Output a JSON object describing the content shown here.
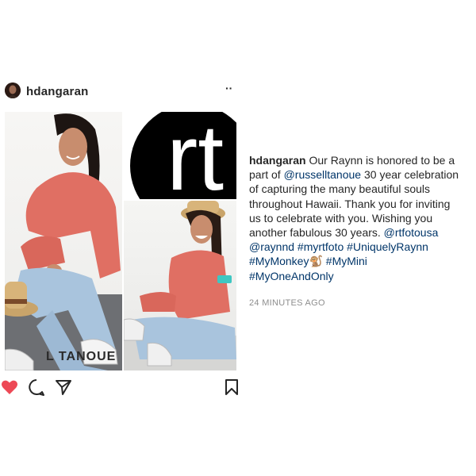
{
  "post": {
    "username": "hdangaran",
    "more_label": "··",
    "watermark": "L TANOUE",
    "logo_text": "rt"
  },
  "caption": {
    "username": "hdangaran",
    "text_part1": "Our Raynn is honored to be a part of",
    "mention_russell": "@russelltanoue",
    "text_part2": "30 year celebration of capturing the many beautiful souls throughout Hawaii. Thank you for inviting us to celebrate with you. Wishing you another fabulous 30 years.",
    "mention_rtfoto": "@rtfotousa",
    "mention_raynnd": "@raynnd",
    "tag_myrtfoto": "#myrtfoto",
    "tag_uniquely": "#UniquelyRaynn",
    "tag_mymonkey": "#MyMonkey",
    "monkey_emoji": "🐒",
    "tag_mymini": "#MyMini",
    "tag_myoneandonly": "#MyOneAndOnly"
  },
  "timestamp": "24 MINUTES AGO",
  "icons": {
    "like": "heart-icon",
    "comment": "comment-icon",
    "share": "share-icon",
    "save": "bookmark-icon"
  },
  "colors": {
    "like": "#ed4956",
    "link": "#003569",
    "timestamp": "#8e8e8e",
    "text": "#262626"
  }
}
